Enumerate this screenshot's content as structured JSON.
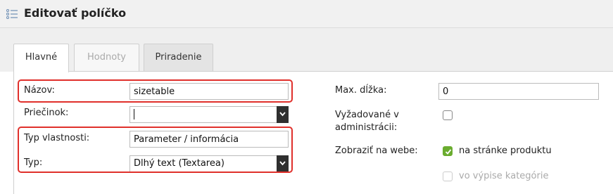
{
  "header": {
    "title": "Editovať políčko",
    "icon": "list-icon"
  },
  "tabs": [
    {
      "label": "Hlavné",
      "state": "active"
    },
    {
      "label": "Hodnoty",
      "state": "disabled"
    },
    {
      "label": "Priradenie",
      "state": "normal"
    }
  ],
  "form": {
    "name_label": "Názov:",
    "name_value": "sizetable",
    "folder_label": "Priečinok:",
    "folder_value": "",
    "property_type_label": "Typ vlastnosti:",
    "property_type_value": "Parameter / informácia",
    "type_label": "Typ:",
    "type_value": "Dlhý text (Textarea)",
    "maxlen_label": "Max. dĺžka:",
    "maxlen_value": "0",
    "required_label_line1": "Vyžadované v",
    "required_label_line2": "administrácii:",
    "required_checked": false,
    "show_label": "Zobraziť na webe:",
    "show_product_label": "na stránke produktu",
    "show_product_checked": true,
    "show_category_label": "vo výpise kategórie",
    "show_category_checked": false,
    "show_category_disabled": true
  },
  "colors": {
    "highlight": "#e0302b",
    "check_green": "#6aac2f"
  }
}
